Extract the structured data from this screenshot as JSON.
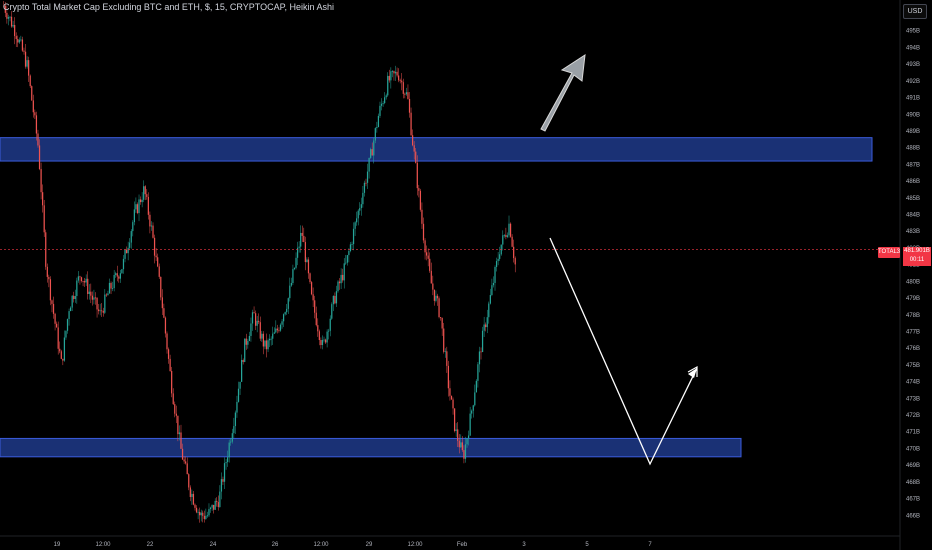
{
  "header": {
    "title": "Crypto Total Market Cap Excluding BTC and ETH, $, 15, CRYPTOCAP, Heikin Ashi",
    "currency": "USD"
  },
  "last_price": {
    "symbol": "TOTAL3",
    "value": "481.901B",
    "countdown": "00:11"
  },
  "colors": {
    "background": "#000000",
    "up": "#26a69a",
    "down": "#ef5350",
    "zone_fill": "#1e3a8a",
    "zone_border": "#3b5bdb",
    "price_line": "#f23645",
    "axis_text": "#b2b5be"
  },
  "chart_data": {
    "type": "candlestick",
    "y_axis": {
      "range": [
        465,
        497
      ],
      "unit": "B",
      "tick_labels": [
        "495B",
        "494B",
        "493B",
        "492B",
        "491B",
        "490B",
        "489B",
        "488B",
        "487B",
        "486B",
        "485B",
        "484B",
        "483B",
        "482B",
        "481B",
        "480B",
        "479B",
        "478B",
        "477B",
        "476B",
        "475B",
        "474B",
        "473B",
        "472B",
        "471B",
        "470B",
        "469B",
        "468B",
        "467B",
        "466B"
      ]
    },
    "x_axis": {
      "tick_labels": [
        "19",
        "12:00",
        "22",
        "24",
        "26",
        "12:00",
        "29",
        "12:00",
        "Feb",
        "3",
        "5",
        "7"
      ]
    },
    "price_path": [
      [
        0,
        496.5
      ],
      [
        0.6,
        495
      ],
      [
        1.2,
        493
      ],
      [
        1.8,
        488
      ],
      [
        2.2,
        481
      ],
      [
        2.6,
        478
      ],
      [
        3.0,
        475
      ],
      [
        3.4,
        478.5
      ],
      [
        4.0,
        480.5
      ],
      [
        4.6,
        479
      ],
      [
        5.0,
        478
      ],
      [
        5.5,
        479.5
      ],
      [
        6.2,
        481
      ],
      [
        6.8,
        484
      ],
      [
        7.3,
        485.5
      ],
      [
        7.7,
        483
      ],
      [
        8.2,
        479
      ],
      [
        8.7,
        474
      ],
      [
        9.2,
        470
      ],
      [
        9.7,
        467.5
      ],
      [
        10.2,
        466
      ],
      [
        10.6,
        466
      ],
      [
        11.2,
        467
      ],
      [
        12.0,
        472
      ],
      [
        12.5,
        476
      ],
      [
        13.0,
        478
      ],
      [
        13.6,
        476
      ],
      [
        14.2,
        477
      ],
      [
        14.8,
        479
      ],
      [
        15.5,
        483
      ],
      [
        16.0,
        479
      ],
      [
        16.6,
        476
      ],
      [
        17.2,
        479
      ],
      [
        17.8,
        481
      ],
      [
        18.4,
        484
      ],
      [
        19.0,
        487
      ],
      [
        19.5,
        490
      ],
      [
        20.0,
        492
      ],
      [
        20.5,
        492.5
      ],
      [
        21.0,
        491
      ],
      [
        21.4,
        487
      ],
      [
        21.8,
        483
      ],
      [
        22.2,
        480
      ],
      [
        22.7,
        478
      ],
      [
        23.1,
        474
      ],
      [
        23.5,
        471
      ],
      [
        23.9,
        469.5
      ],
      [
        24.3,
        472
      ],
      [
        24.8,
        476
      ],
      [
        25.3,
        479
      ],
      [
        25.8,
        482
      ],
      [
        26.3,
        483.5
      ],
      [
        26.6,
        481
      ]
    ],
    "zones": [
      {
        "name": "resistance",
        "from": 487.2,
        "to": 488.6
      },
      {
        "name": "support",
        "from": 469.5,
        "to": 470.6
      }
    ],
    "last_price": 481.901
  }
}
